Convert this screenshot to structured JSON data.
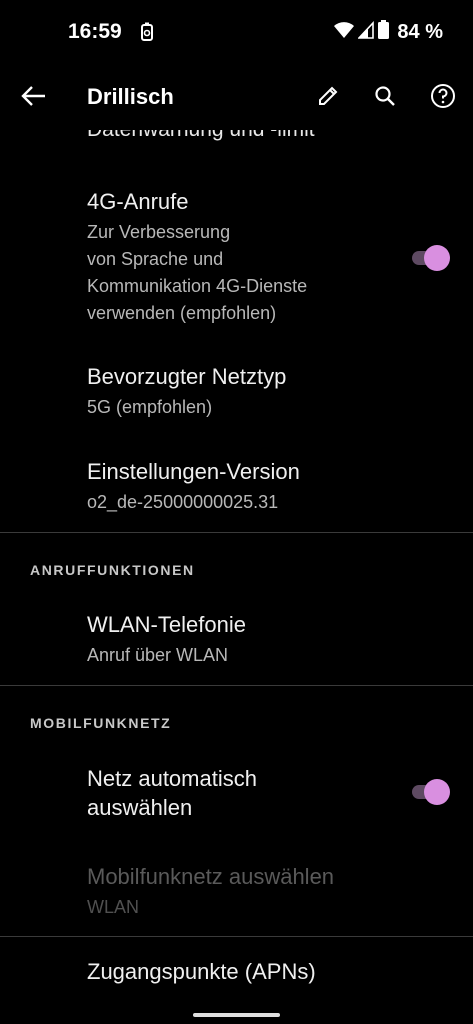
{
  "status_bar": {
    "time": "16:59",
    "battery": "84 %",
    "icons": [
      "alarm-icon",
      "wifi-icon",
      "signal-icon",
      "battery-icon"
    ]
  },
  "app_bar": {
    "title": "Drillisch",
    "icons": [
      "back-arrow-icon",
      "pencil-icon",
      "search-icon",
      "help-icon"
    ]
  },
  "content": {
    "cut_off_item": "Datenwarnung und -limit",
    "items": [
      {
        "title": "4G-Anrufe",
        "subtitle_lines": [
          "Zur Verbesserung",
          "von Sprache und",
          "Kommunikation 4G-Dienste",
          "verwenden (empfohlen)"
        ],
        "toggle": true
      },
      {
        "title": "Bevorzugter Netztyp",
        "subtitle": "5G (empfohlen)"
      },
      {
        "title": "Einstellungen-Version",
        "subtitle": "o2_de-25000000025.31"
      }
    ],
    "section_call": {
      "header": "ANRUFFUNKTIONEN",
      "items": [
        {
          "title": "WLAN-Telefonie",
          "subtitle": "Anruf über WLAN"
        }
      ]
    },
    "section_mobile": {
      "header": "MOBILFUNKNETZ",
      "items": [
        {
          "title_lines": [
            "Netz automatisch",
            "auswählen"
          ],
          "toggle": true
        },
        {
          "title": "Mobilfunknetz auswählen",
          "subtitle": "WLAN",
          "disabled": true
        },
        {
          "title": "Zugangspunkte (APNs)"
        }
      ]
    }
  },
  "colors": {
    "accent": "#d98fe0",
    "track": "#5e4a62",
    "background": "#000000"
  }
}
